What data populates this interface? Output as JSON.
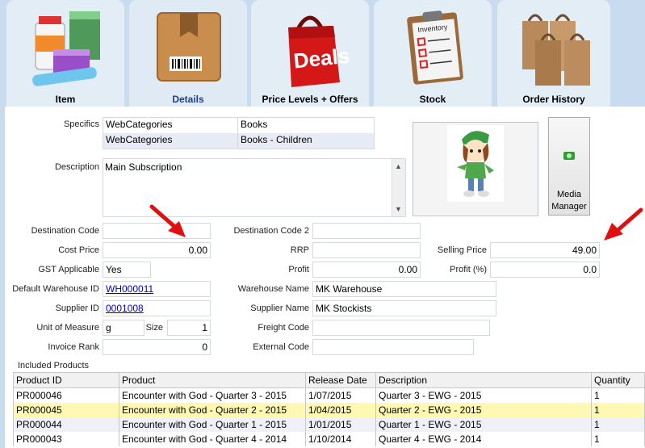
{
  "tabs": [
    {
      "label": "Item",
      "icon": "products-icon"
    },
    {
      "label": "Details",
      "icon": "box-icon"
    },
    {
      "label": "Price Levels + Offers",
      "icon": "deals-bag-icon"
    },
    {
      "label": "Stock",
      "icon": "inventory-clipboard-icon"
    },
    {
      "label": "Order History",
      "icon": "shopping-bags-icon"
    }
  ],
  "deals_text": "Deals",
  "inventory_text": "Inventory",
  "specifics": {
    "label": "Specifics",
    "rows": [
      {
        "category": "WebCategories",
        "value": "Books"
      },
      {
        "category": "WebCategories",
        "value": "Books - Children"
      }
    ]
  },
  "description": {
    "label": "Description",
    "value": "Main Subscription"
  },
  "media_manager": {
    "label_line1": "Media",
    "label_line2": "Manager"
  },
  "fields": {
    "destination_code": {
      "label": "Destination Code",
      "value": ""
    },
    "destination_code_2": {
      "label": "Destination Code 2",
      "value": ""
    },
    "cost_price": {
      "label": "Cost Price",
      "value": "0.00"
    },
    "rrp": {
      "label": "RRP",
      "value": ""
    },
    "selling_price": {
      "label": "Selling Price",
      "value": "49.00"
    },
    "gst_applicable": {
      "label": "GST Applicable",
      "value": "Yes"
    },
    "profit": {
      "label": "Profit",
      "value": "0.00"
    },
    "profit_pct": {
      "label": "Profit (%)",
      "value": "0.0"
    },
    "default_warehouse_id": {
      "label": "Default Warehouse ID",
      "value": "WH000011"
    },
    "warehouse_name": {
      "label": "Warehouse Name",
      "value": "MK Warehouse"
    },
    "supplier_id": {
      "label": "Supplier ID",
      "value": "0001008"
    },
    "supplier_name": {
      "label": "Supplier Name",
      "value": "MK Stockists"
    },
    "unit_of_measure": {
      "label": "Unit of Measure",
      "value": "g"
    },
    "size": {
      "label": "Size",
      "value": "1"
    },
    "freight_code": {
      "label": "Freight Code",
      "value": ""
    },
    "invoice_rank": {
      "label": "Invoice Rank",
      "value": "0"
    },
    "external_code": {
      "label": "External Code",
      "value": ""
    }
  },
  "included_products": {
    "label": "Included Products",
    "columns": [
      "Product ID",
      "Product",
      "Release Date",
      "Description",
      "Quantity"
    ],
    "rows": [
      [
        "PR000046",
        "Encounter with God - Quarter 3 - 2015",
        "1/07/2015",
        "Quarter 3 - EWG - 2015",
        "1"
      ],
      [
        "PR000045",
        "Encounter with God - Quarter 2 - 2015",
        "1/04/2015",
        "Quarter 2 - EWG - 2015",
        "1"
      ],
      [
        "PR000044",
        "Encounter with God - Quarter 1 - 2015",
        "1/01/2015",
        "Quarter 1 - EWG - 2015",
        "1"
      ],
      [
        "PR000043",
        "Encounter with God - Quarter 4 - 2014",
        "1/10/2014",
        "Quarter 4 - EWG - 2014",
        "1"
      ]
    ]
  },
  "colors": {
    "accent": "#1f3f86",
    "arrow": "#e01010",
    "selected_row": "#fff8b3"
  }
}
